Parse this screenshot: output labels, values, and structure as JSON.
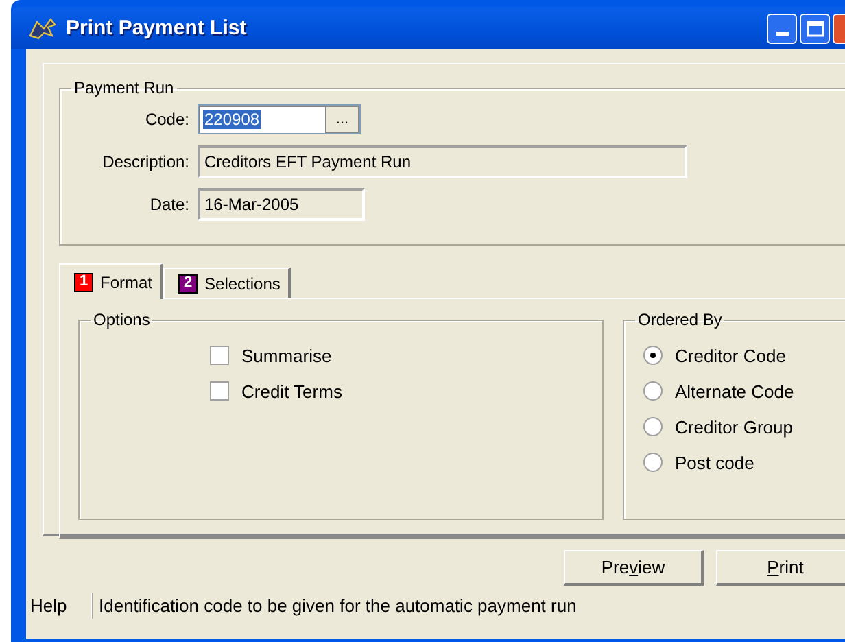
{
  "window": {
    "title": "Print Payment List"
  },
  "payment_run": {
    "legend": "Payment Run",
    "fields": [
      {
        "label": "Code:",
        "value": "220908",
        "kind": "lookup",
        "selected": true,
        "button": "..."
      },
      {
        "label": "Description:",
        "value": "Creditors EFT Payment Run",
        "kind": "readonly",
        "selected": false
      },
      {
        "label": "Date:",
        "value": "16-Mar-2005",
        "kind": "readonly",
        "selected": false
      }
    ]
  },
  "tabs": [
    {
      "number": "1",
      "color": "#ff0000",
      "label": "Format",
      "selected": true
    },
    {
      "number": "2",
      "color": "#800080",
      "label": "Selections",
      "selected": false
    }
  ],
  "options": {
    "legend": "Options",
    "items": [
      {
        "label": "Summarise",
        "checked": false
      },
      {
        "label": "Credit Terms",
        "checked": false
      }
    ]
  },
  "ordered_by": {
    "legend": "Ordered By",
    "items": [
      {
        "label": "Creditor Code",
        "selected": true
      },
      {
        "label": "Alternate Code",
        "selected": false
      },
      {
        "label": "Creditor Group",
        "selected": false
      },
      {
        "label": "Post code",
        "selected": false
      }
    ]
  },
  "buttons": [
    {
      "before": "Pre",
      "access_key": "v",
      "after": "iew"
    },
    {
      "access_key": "P",
      "after": "rint"
    }
  ],
  "status_bar": {
    "label": "Help",
    "message": "Identification code to be given for the automatic payment run"
  }
}
